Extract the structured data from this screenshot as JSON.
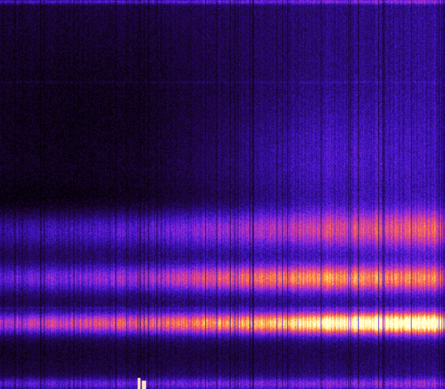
{
  "image": {
    "kind": "spectrogram-heatmap",
    "colormap": "magma",
    "colormap_stops": [
      "#000000",
      "#1a0530",
      "#2a0a7a",
      "#4a18d8",
      "#9a2cd8",
      "#e04090",
      "#ff7a3a",
      "#ffd060",
      "#ffffd0"
    ],
    "background_color": "#05010f",
    "grid_line_color": "#2b0f5a",
    "has_axes": false,
    "has_labels": false,
    "has_legend": false
  }
}
